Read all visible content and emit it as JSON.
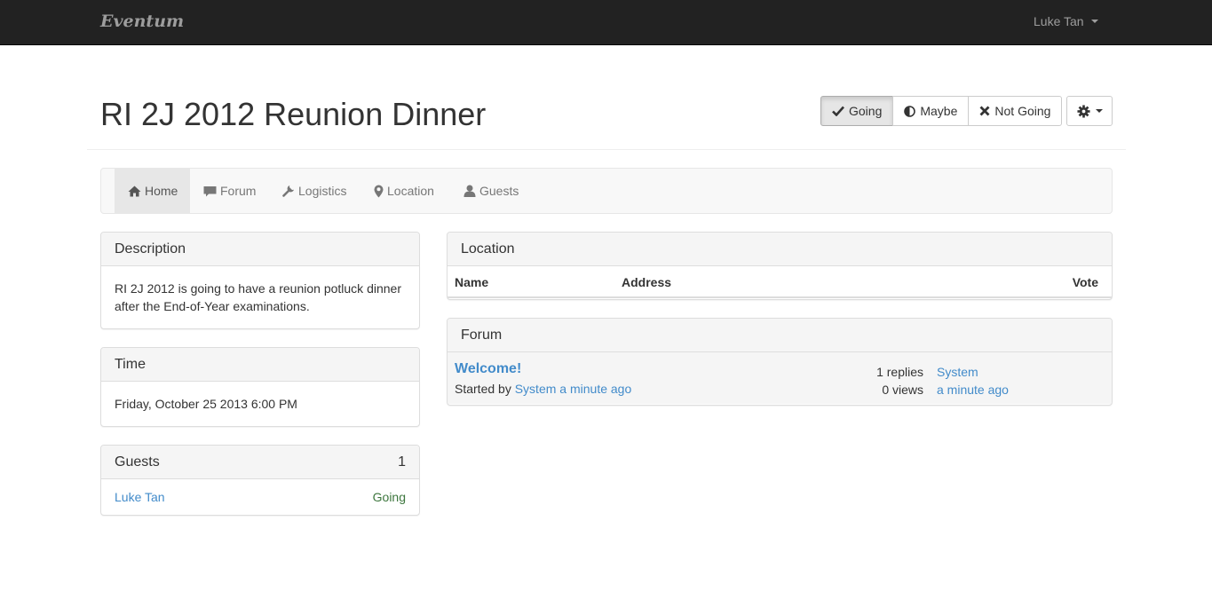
{
  "navbar": {
    "brand": "Eventum",
    "user": "Luke Tan"
  },
  "header": {
    "title": "RI 2J 2012 Reunion Dinner",
    "rsvp": [
      {
        "label": "Going",
        "icon": "check-icon",
        "active": true
      },
      {
        "label": "Maybe",
        "icon": "half-circle-icon",
        "active": false
      },
      {
        "label": "Not Going",
        "icon": "x-icon",
        "active": false
      }
    ],
    "settings_icon": "gear-icon"
  },
  "tabs": [
    {
      "label": "Home",
      "icon": "home-icon",
      "active": true
    },
    {
      "label": "Forum",
      "icon": "comment-icon",
      "active": false
    },
    {
      "label": "Logistics",
      "icon": "wrench-icon",
      "active": false
    },
    {
      "label": "Location",
      "icon": "map-marker-icon",
      "active": false
    },
    {
      "label": "Guests",
      "icon": "user-icon",
      "active": false
    }
  ],
  "description": {
    "heading": "Description",
    "line1": "RI 2J 2012 is going to have a reunion potluck dinner",
    "line2": "after the End-of-Year examinations."
  },
  "time": {
    "heading": "Time",
    "value": "Friday, October 25 2013 6:00 PM"
  },
  "guests": {
    "heading": "Guests",
    "count": "1",
    "items": [
      {
        "name": "Luke Tan",
        "status": "Going"
      }
    ]
  },
  "location": {
    "heading": "Location",
    "columns": [
      "Name",
      "Address",
      "Vote"
    ]
  },
  "forum": {
    "heading": "Forum",
    "topics": [
      {
        "title": "Welcome!",
        "started_prefix": "Started by",
        "author": "System",
        "started_when": "a minute ago",
        "replies": "1 replies",
        "views": "0 views",
        "last_author": "System",
        "last_when": "a minute ago"
      }
    ]
  },
  "colors": {
    "navbar_bg": "#222222",
    "link": "#428bca",
    "going": "#3c763d"
  }
}
